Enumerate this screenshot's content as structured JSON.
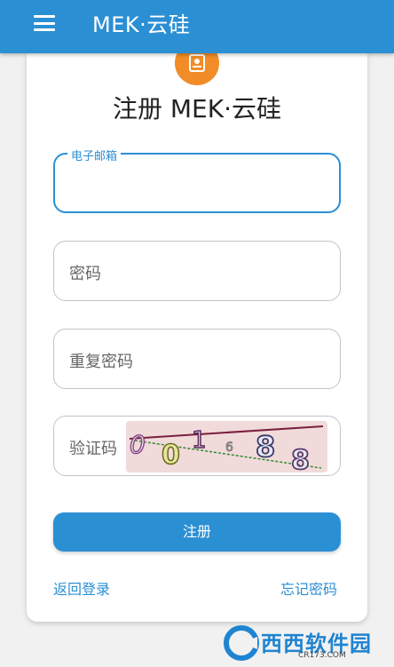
{
  "appbar": {
    "title": "MEK·云硅"
  },
  "form": {
    "title": "注册 MEK·云硅",
    "email_label": "电子邮箱",
    "email_value": "",
    "password_placeholder": "密码",
    "confirm_placeholder": "重复密码",
    "captcha_placeholder": "验证码",
    "submit_label": "注册",
    "login_link": "返回登录",
    "forgot_link": "忘记密码"
  },
  "captcha_chars": [
    "0",
    "0",
    "1",
    "6",
    "8",
    "8"
  ],
  "colors": {
    "primary": "#2b8fd4",
    "badge": "#f28c28"
  },
  "watermark": {
    "main": "西西软件园",
    "sub": "CR173.COM"
  }
}
